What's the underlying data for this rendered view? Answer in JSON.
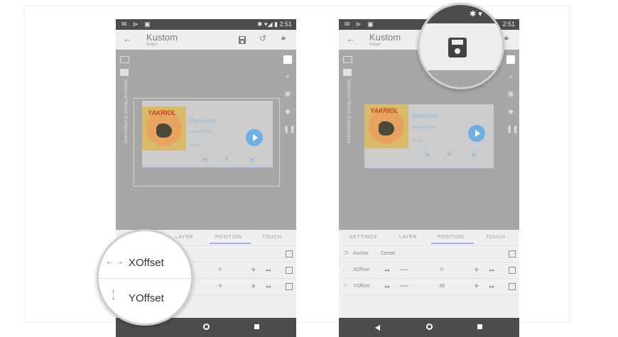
{
  "status_bar": {
    "left_icons": "✉ ⊳ ▣",
    "right_icons": "✱ ▾◢ ▮",
    "time": "2:51"
  },
  "app": {
    "title": "Kustom",
    "subtitle": "Widget",
    "back_icon": "arrow-left-icon"
  },
  "toolbar_icons": [
    "save-icon",
    "history-icon",
    "lock-icon"
  ],
  "sidebar": {
    "vertical_label": "Material Music Komponent"
  },
  "widget": {
    "album_text": "YAKRIOL",
    "track_title": "Patchesta",
    "artist": "Grupo Di Bolei",
    "album": "Vereal"
  },
  "tabs": {
    "left_phone": [
      "LAYER",
      "POSITION",
      "TOUCH"
    ],
    "right_phone": [
      "SETTINGS",
      "LAYER",
      "POSITION",
      "TOUCH"
    ],
    "active": "POSITION"
  },
  "rows": {
    "anchor_label": "Anchor",
    "anchor_value": "Center",
    "xoffset_label": "XOffset",
    "xoffset_value_left": "0",
    "yoffset_value_left": "-6",
    "xoffset_value_right": "0",
    "yoffset_label": "YOffset",
    "yoffset_value_right": "-38"
  },
  "magnifier_left": {
    "x_label": "XOffset",
    "y_label": "YOffset"
  },
  "colors": {
    "accent": "#6fb0e4",
    "tab_indicator": "#a6b2e6",
    "status_bar": "#4d4d4d"
  }
}
